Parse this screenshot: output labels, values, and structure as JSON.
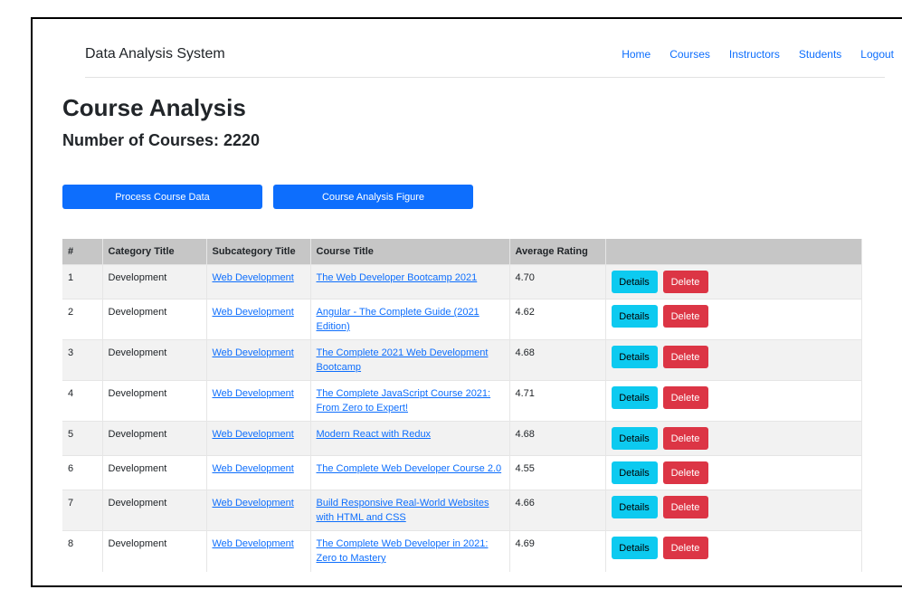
{
  "navbar": {
    "brand": "Data Analysis System",
    "links": [
      "Home",
      "Courses",
      "Instructors",
      "Students",
      "Logout"
    ]
  },
  "page": {
    "title": "Course Analysis",
    "subtitle": "Number of Courses: 2220"
  },
  "buttons": {
    "process": "Process Course Data",
    "figure": "Course Analysis Figure"
  },
  "table": {
    "headers": [
      "#",
      "Category Title",
      "Subcategory Title",
      "Course Title",
      "Average Rating",
      ""
    ],
    "actions": {
      "details": "Details",
      "delete": "Delete"
    },
    "rows": [
      {
        "num": "1",
        "category": "Development",
        "subcategory": "Web Development",
        "course": "The Web Developer Bootcamp 2021",
        "rating": "4.70"
      },
      {
        "num": "2",
        "category": "Development",
        "subcategory": "Web Development",
        "course": "Angular - The Complete Guide (2021 Edition)",
        "rating": "4.62"
      },
      {
        "num": "3",
        "category": "Development",
        "subcategory": "Web Development",
        "course": "The Complete 2021 Web Development Bootcamp",
        "rating": "4.68"
      },
      {
        "num": "4",
        "category": "Development",
        "subcategory": "Web Development",
        "course": "The Complete JavaScript Course 2021: From Zero to Expert!",
        "rating": "4.71"
      },
      {
        "num": "5",
        "category": "Development",
        "subcategory": "Web Development",
        "course": "Modern React with Redux",
        "rating": "4.68"
      },
      {
        "num": "6",
        "category": "Development",
        "subcategory": "Web Development",
        "course": "The Complete Web Developer Course 2.0",
        "rating": "4.55"
      },
      {
        "num": "7",
        "category": "Development",
        "subcategory": "Web Development",
        "course": "Build Responsive Real-World Websites with HTML and CSS",
        "rating": "4.66"
      },
      {
        "num": "8",
        "category": "Development",
        "subcategory": "Web Development",
        "course": "The Complete Web Developer in 2021: Zero to Mastery",
        "rating": "4.69"
      }
    ]
  },
  "colors": {
    "primary": "#0d6efd",
    "info": "#0dcaf0",
    "danger": "#dc3545",
    "header_bg": "#c6c6c6"
  }
}
